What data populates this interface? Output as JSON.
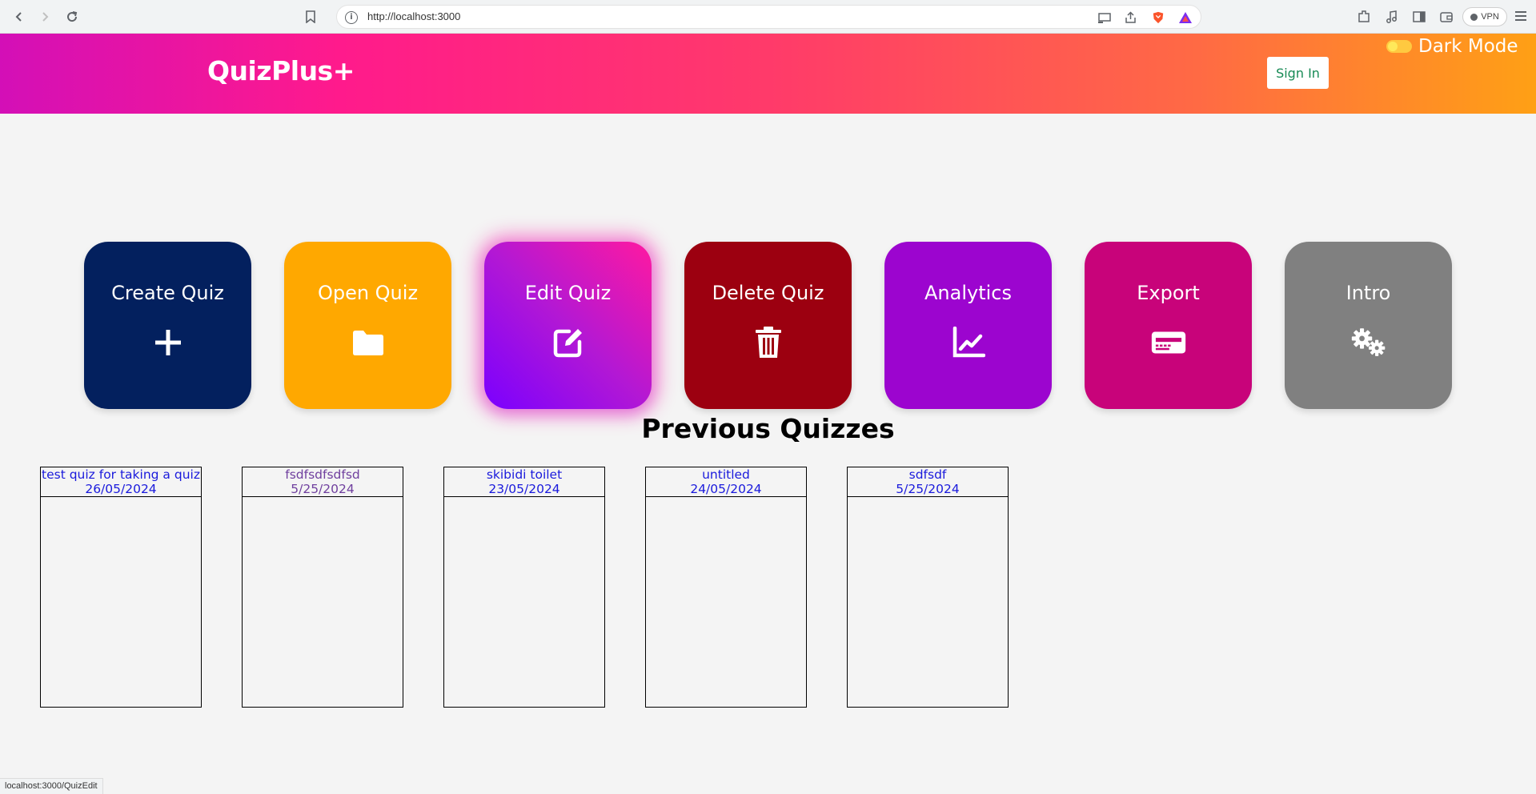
{
  "browser": {
    "url": "http://localhost:3000",
    "vpn_label": "VPN",
    "status_url": "localhost:3000/QuizEdit"
  },
  "header": {
    "logo": "QuizPlus+",
    "signin_label": "Sign In",
    "dark_mode_label": "Dark Mode",
    "gradient_colors": [
      "#d30fb7",
      "#ff1a8c",
      "#ff6a44",
      "#ffa015"
    ]
  },
  "tiles": [
    {
      "label": "Create Quiz",
      "icon": "plus-icon",
      "color": "#03205e"
    },
    {
      "label": "Open Quiz",
      "icon": "folder-icon",
      "color": "#ffa800"
    },
    {
      "label": "Edit Quiz",
      "icon": "edit-icon",
      "color": "#b318d4"
    },
    {
      "label": "Delete Quiz",
      "icon": "trash-icon",
      "color": "#9c0010"
    },
    {
      "label": "Analytics",
      "icon": "chart-line-icon",
      "color": "#9c05cf"
    },
    {
      "label": "Export",
      "icon": "export-card-icon",
      "color": "#c8037a"
    },
    {
      "label": "Intro",
      "icon": "gears-icon",
      "color": "#808080"
    }
  ],
  "previous_quizzes": {
    "title": "Previous Quizzes",
    "items": [
      {
        "name": "test quiz for taking a quiz",
        "date": "26/05/2024"
      },
      {
        "name": "fsdfsdfsdfsd",
        "date": "5/25/2024"
      },
      {
        "name": "skibidi toilet",
        "date": "23/05/2024"
      },
      {
        "name": "untitled",
        "date": "24/05/2024"
      },
      {
        "name": "sdfsdf",
        "date": "5/25/2024"
      }
    ]
  }
}
